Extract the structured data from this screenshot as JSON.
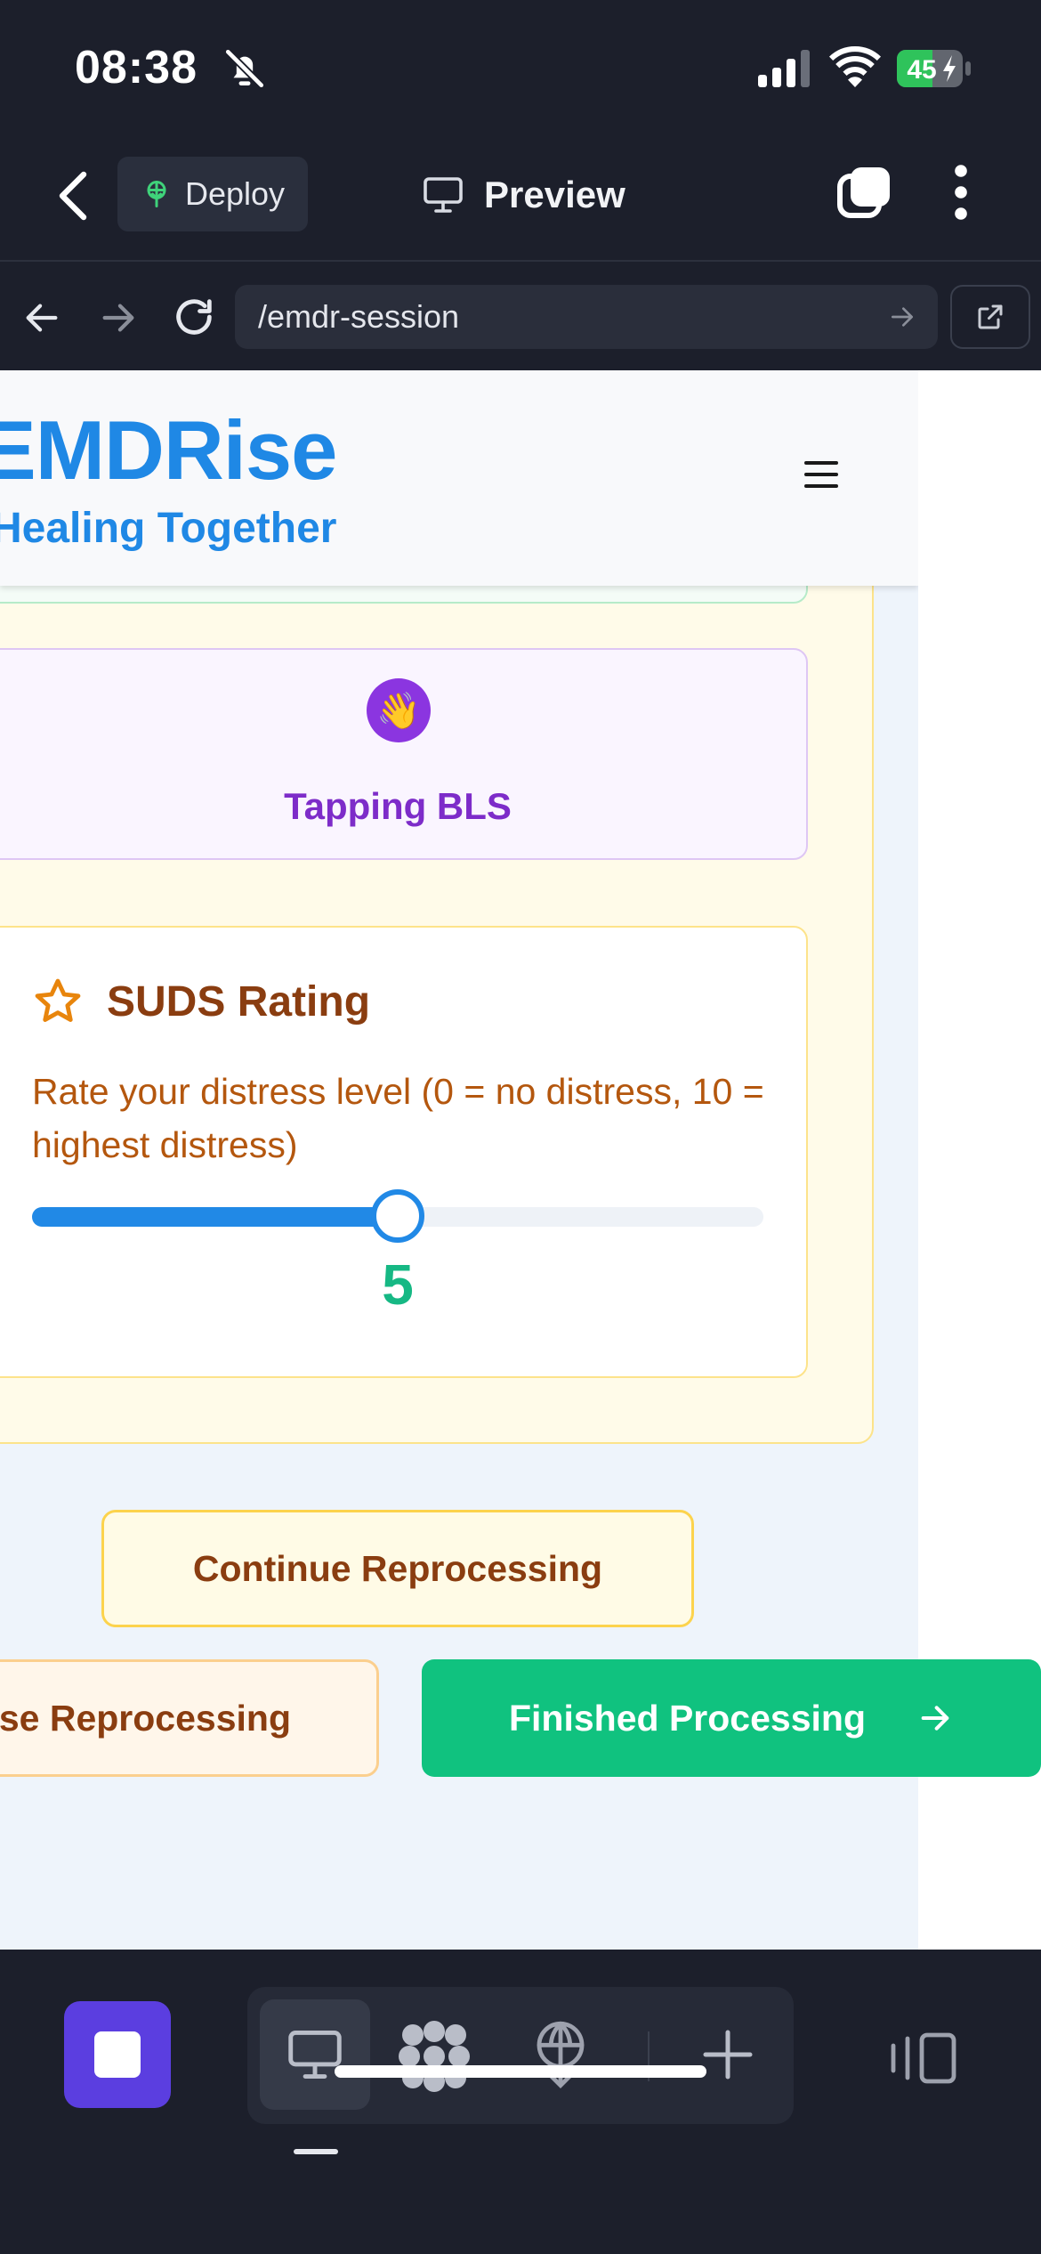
{
  "status_bar": {
    "time": "08:38",
    "battery_level": "45",
    "icons": [
      "bell-muted-icon",
      "cellular-signal-icon",
      "wifi-icon",
      "battery-charging-icon"
    ]
  },
  "app_toolbar": {
    "deploy_label": "Deploy",
    "preview_label": "Preview",
    "icons": [
      "back-chevron-icon",
      "deploy-icon",
      "monitor-icon",
      "tabs-icon",
      "more-vertical-icon"
    ]
  },
  "browser": {
    "url": "/emdr-session",
    "icons": [
      "arrow-left-icon",
      "arrow-right-icon",
      "reload-icon",
      "go-arrow-icon",
      "open-external-icon"
    ]
  },
  "site": {
    "brand_name": "EMDRise",
    "brand_tagline": "Healing Together"
  },
  "bls": {
    "icon": "👋",
    "label": "Tapping BLS",
    "accent_color": "#7d2cc9"
  },
  "suds": {
    "title": "SUDS Rating",
    "description": "Rate your distress level (0 = no distress, 10 = highest distress)",
    "min": 0,
    "max": 10,
    "value": 5,
    "value_label": "5",
    "accent_color": "#2189e6"
  },
  "actions": {
    "continue_label": "Continue Reprocessing",
    "pause_label": "Pause Reprocessing",
    "finish_label": "Finished Processing",
    "finish_color": "#10c27f"
  },
  "bottom_bar": {
    "icons": [
      "stop-icon",
      "desktop-icon",
      "apps-grid-icon",
      "deploy-icon",
      "add-icon",
      "panel-icon"
    ]
  }
}
